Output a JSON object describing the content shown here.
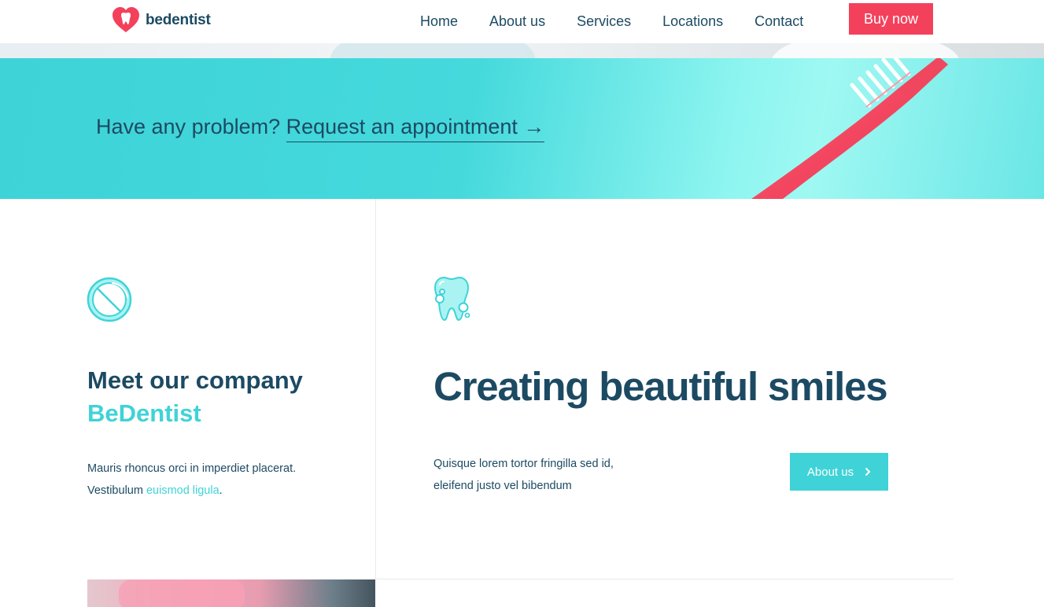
{
  "brand": {
    "name": "bedentist",
    "logo_color": "#f4415b"
  },
  "nav": {
    "items": [
      {
        "label": "Home"
      },
      {
        "label": "About us"
      },
      {
        "label": "Services"
      },
      {
        "label": "Locations"
      },
      {
        "label": "Contact"
      }
    ],
    "cta_label": "Buy now"
  },
  "banner": {
    "question": "Have any problem?",
    "link_text": "Request an appointment →"
  },
  "company": {
    "icon": "tooth-ban-icon",
    "title": "Meet our company",
    "title_accent": "BeDentist",
    "text_line1": "Mauris rhoncus orci in imperdiet placerat.",
    "text_line2_prefix": "Vestibulum ",
    "text_line2_link": "euismod ligula",
    "text_line2_suffix": "."
  },
  "smiles": {
    "icon": "clean-tooth-icon",
    "title": "Creating beautiful smiles",
    "text_line1": "Quisque lorem tortor fringilla sed id,",
    "text_line2": "eleifend justo vel bibendum",
    "button_label": "About us"
  },
  "colors": {
    "accent": "#3fd3d7",
    "brand_red": "#f4415b",
    "text": "#1c4a63"
  }
}
